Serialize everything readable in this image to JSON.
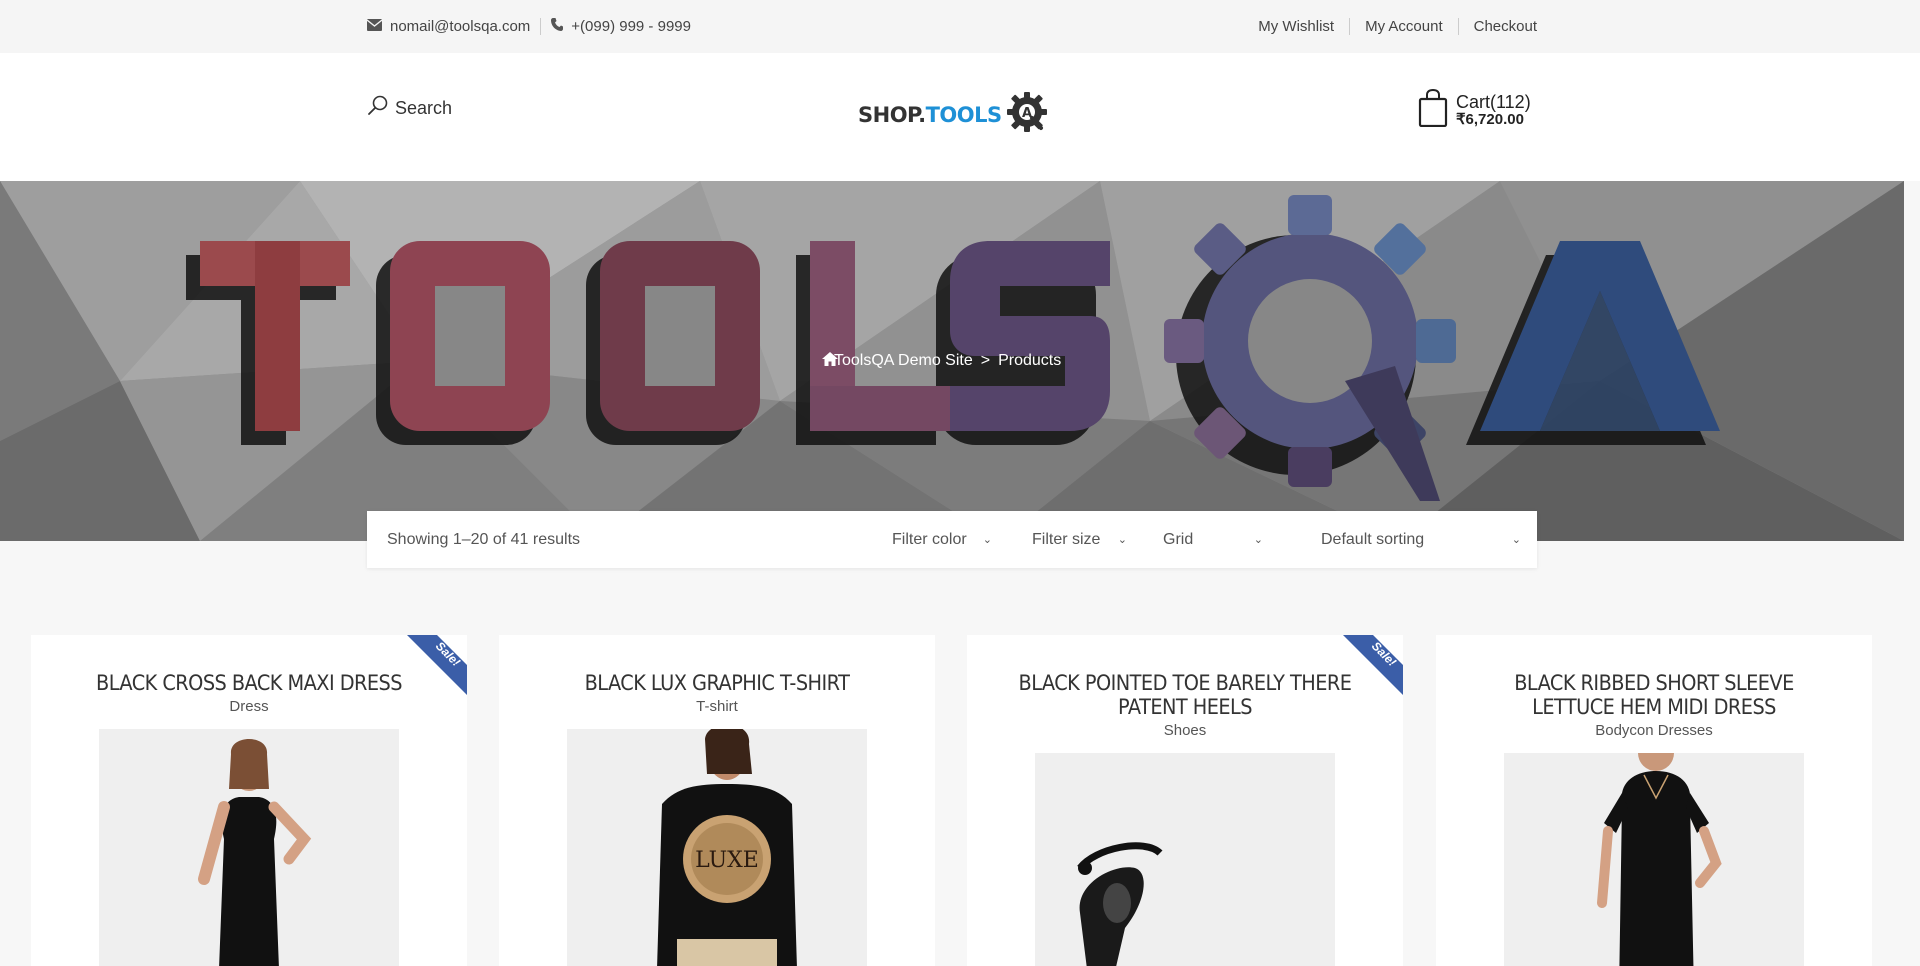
{
  "topbar": {
    "email": "nomail@toolsqa.com",
    "phone": "+(099) 999 - 9999",
    "links": [
      "My Wishlist",
      "My Account",
      "Checkout"
    ]
  },
  "header": {
    "search_label": "Search",
    "logo_shop": "SHOP.",
    "logo_tools": "TOOLS",
    "cart_label": "Cart(112)",
    "cart_total": "₹6,720.00"
  },
  "banner": {
    "logo_text": "TOOLSQA",
    "breadcrumb_home": "ToolsQA Demo Site",
    "breadcrumb_sep": ">",
    "breadcrumb_current": "Products"
  },
  "toolbar": {
    "results": "Showing 1–20 of 41 results",
    "filter_color": "Filter color",
    "filter_size": "Filter size",
    "view": "Grid",
    "sorting": "Default sorting"
  },
  "products": [
    {
      "title": "BLACK CROSS BACK MAXI DRESS",
      "category": "Dress",
      "sale": "Sale!"
    },
    {
      "title": "BLACK LUX GRAPHIC T-SHIRT",
      "category": "T-shirt",
      "sale": ""
    },
    {
      "title": "BLACK POINTED TOE BARELY THERE PATENT HEELS",
      "category": "Shoes",
      "sale": "Sale!"
    },
    {
      "title": "BLACK RIBBED SHORT SLEEVE LETTUCE HEM MIDI DRESS",
      "category": "Bodycon Dresses",
      "sale": ""
    }
  ],
  "colors": {
    "accent_blue": "#1e90d6",
    "sale_ribbon": "#3b5ea8",
    "banner_bg": "#8a8a8a"
  }
}
